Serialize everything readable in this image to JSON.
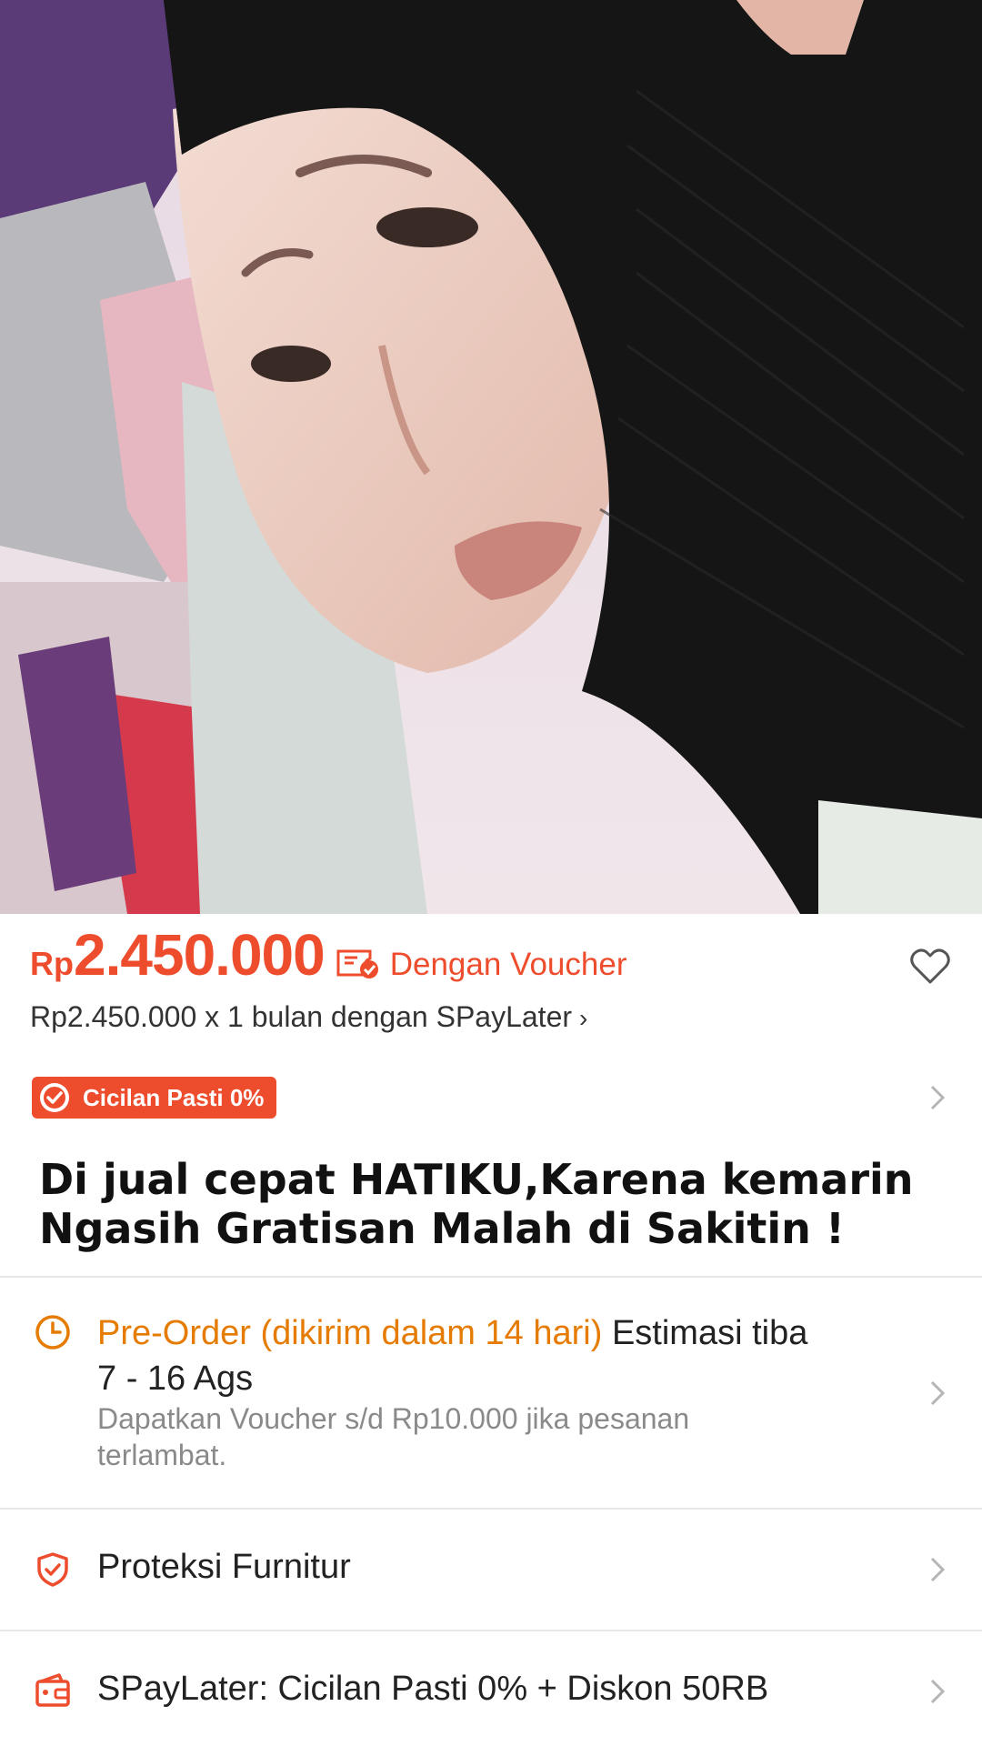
{
  "product": {
    "price_currency": "Rp",
    "price_amount": "2.450.000",
    "voucher_label": "Dengan Voucher",
    "paylater_text": "Rp2.450.000 x 1 bulan dengan SPayLater",
    "paylater_chevron": "›",
    "badge_label": "Cicilan Pasti 0%",
    "title": "Di jual cepat HATIKU,Karena kemarin Ngasih Gratisan Malah di Sakitin !"
  },
  "shipping": {
    "preorder_label": "Pre-Order (dikirim dalam 14 hari)",
    "estimate_prefix": "Estimasi tiba",
    "estimate_dates": "7 - 16 Ags",
    "voucher_note": "Dapatkan Voucher s/d Rp10.000 jika pesanan terlambat."
  },
  "rows": {
    "protection_label": "Proteksi Furnitur",
    "spaylater_label": "SPayLater: Cicilan Pasti 0% + Diskon 50RB"
  },
  "icons": {
    "voucher": "ticket-icon",
    "favorite": "heart-icon",
    "badge": "check-badge-icon",
    "clock": "clock-icon",
    "shield": "shield-icon",
    "wallet": "wallet-icon",
    "chevron": "chevron-right-icon"
  },
  "colors": {
    "accent": "#ee4d2d",
    "preorder": "#e57b00",
    "muted": "#8a8a8a"
  }
}
